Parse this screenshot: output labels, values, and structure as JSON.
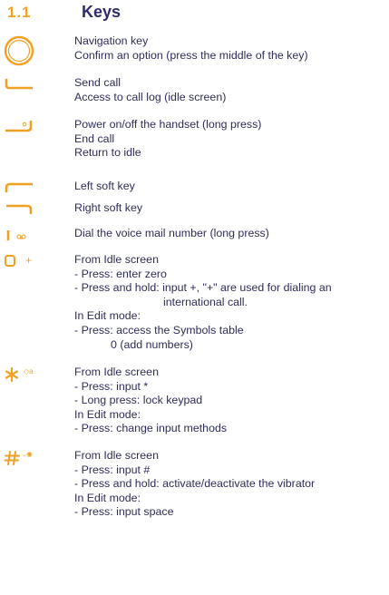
{
  "section": {
    "number": "1.1",
    "title": "Keys"
  },
  "colors": {
    "accent": "#f0a024",
    "text": "#2d2d5a",
    "title": "#2d2d6e"
  },
  "keys": [
    {
      "icon": "navigation-key-icon",
      "lines": [
        "Navigation key",
        "Confirm an option (press the middle of the key)"
      ]
    },
    {
      "icon": "send-key-icon",
      "lines": [
        "Send call",
        "Access to call log (idle screen)"
      ]
    },
    {
      "icon": "end-key-icon",
      "lines": [
        "Power on/off the handset (long press)",
        "End call",
        "Return to idle"
      ]
    },
    {
      "icon": "left-soft-key-icon",
      "lines": [
        "Left soft key"
      ]
    },
    {
      "icon": "right-soft-key-icon",
      "lines": [
        "Right soft key"
      ]
    },
    {
      "icon": "voicemail-key-icon",
      "lines": [
        "Dial the voice mail number (long press)"
      ]
    },
    {
      "icon": "zero-key-icon",
      "glyph": "+",
      "lines": [
        "From Idle screen",
        "- Press: enter zero",
        "- Press and hold: input +, \"+\" are used for dialing an",
        "international call.",
        "In Edit mode:",
        "- Press: access the Symbols table",
        "0 (add numbers)"
      ]
    },
    {
      "icon": "star-key-icon",
      "glyph": "◇a",
      "lines": [
        "From Idle screen",
        "- Press: input *",
        "- Long press: lock keypad",
        "In Edit mode:",
        "- Press: change input methods"
      ]
    },
    {
      "icon": "hash-key-icon",
      "glyph": "⌣◉",
      "lines": [
        "From Idle screen",
        "- Press: input #",
        "- Press and hold: activate/deactivate the vibrator",
        "In Edit mode:",
        "- Press: input space"
      ]
    }
  ]
}
